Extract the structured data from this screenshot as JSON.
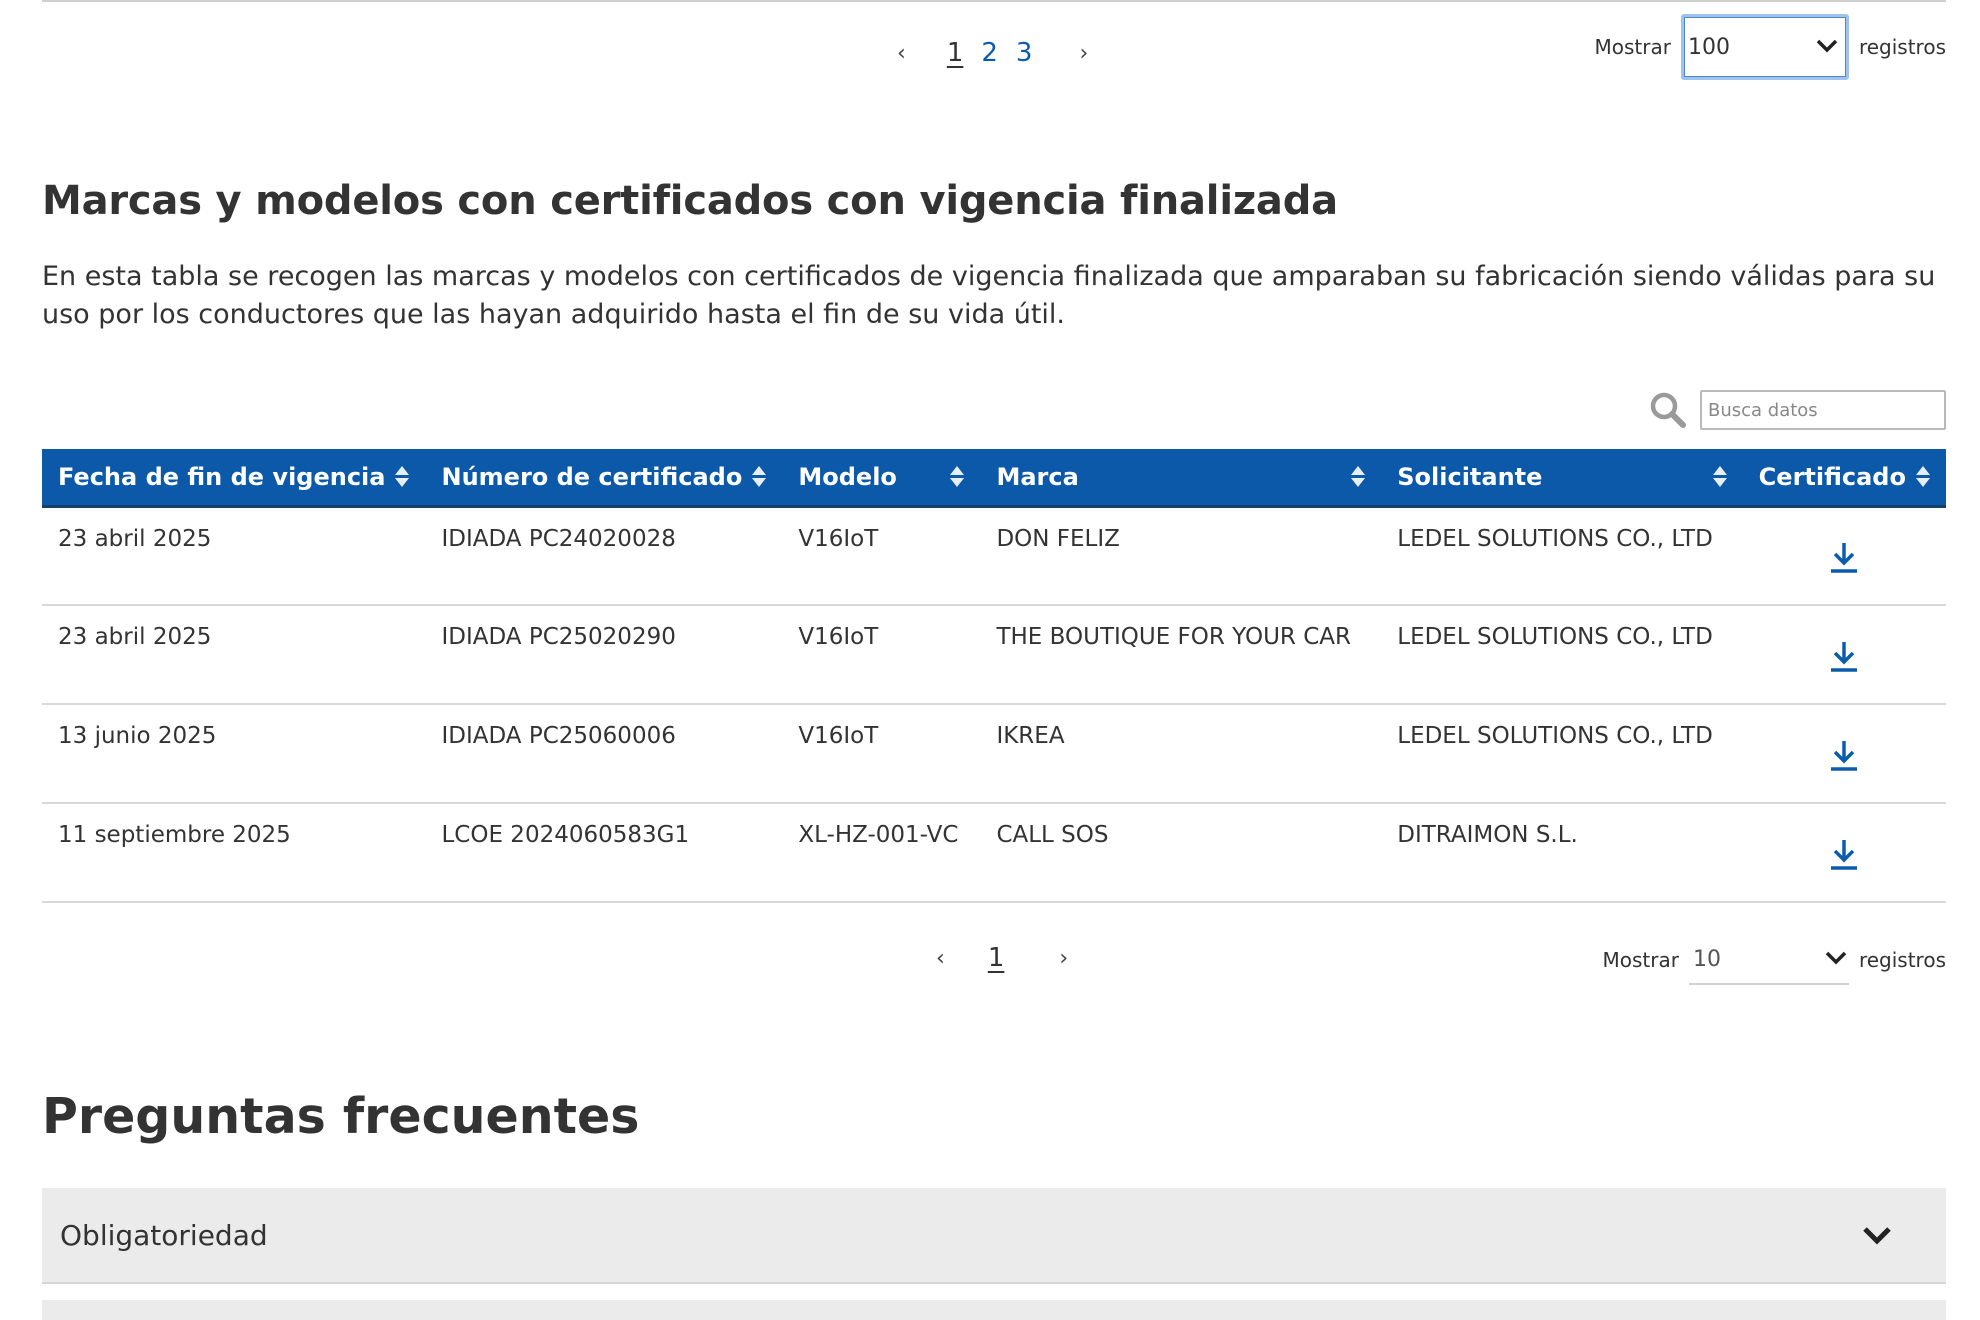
{
  "pagination_top": {
    "prev": "‹",
    "next": "›",
    "pages": [
      "1",
      "2",
      "3"
    ],
    "current": "1"
  },
  "show_top": {
    "label": "Mostrar",
    "value": "100",
    "suffix": "registros"
  },
  "section": {
    "title": "Marcas y modelos con certificados con vigencia finalizada",
    "description": "En esta tabla se recogen las marcas y modelos con certificados de vigencia finalizada que amparaban su fabricación siendo válidas para su uso por los conductores que las hayan adquirido hasta el fin de su vida útil."
  },
  "search": {
    "placeholder": "Busca datos",
    "icon": "search-icon"
  },
  "table": {
    "headers": [
      "Fecha de fin de vigencia",
      "Número de certificado",
      "Modelo",
      "Marca",
      "Solicitante",
      "Certificado"
    ],
    "rows": [
      [
        "23 abril 2025",
        "IDIADA PC24020028",
        "V16IoT",
        "DON FELIZ",
        "LEDEL SOLUTIONS CO., LTD"
      ],
      [
        "23 abril 2025",
        "IDIADA PC25020290",
        "V16IoT",
        "THE BOUTIQUE FOR YOUR CAR",
        "LEDEL SOLUTIONS CO., LTD"
      ],
      [
        "13 junio 2025",
        "IDIADA PC25060006",
        "V16IoT",
        "IKREA",
        "LEDEL SOLUTIONS CO., LTD"
      ],
      [
        "11 septiembre 2025",
        "LCOE 2024060583G1",
        "XL-HZ-001-VC",
        "CALL SOS",
        "DITRAIMON S.L."
      ]
    ],
    "header_color": "#0b59a8",
    "download_icon": "download-icon"
  },
  "pagination_bottom": {
    "prev": "‹",
    "next": "›",
    "pages": [
      "1"
    ],
    "current": "1"
  },
  "show_bottom": {
    "label": "Mostrar",
    "value": "10",
    "suffix": "registros"
  },
  "faq": {
    "title": "Preguntas frecuentes",
    "items": [
      {
        "label": "Obligatoriedad"
      }
    ]
  },
  "colors": {
    "link": "#0b5cad",
    "accordion_bg": "#ebebeb"
  }
}
